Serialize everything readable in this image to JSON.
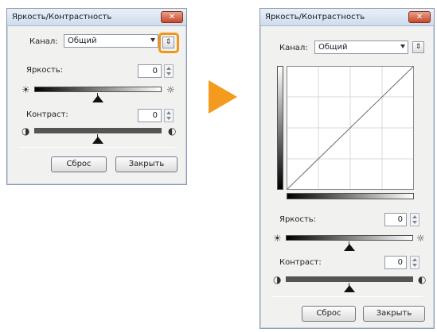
{
  "window1": {
    "title": "Яркость/Контрастность",
    "close": "✕",
    "channel_label": "Канал:",
    "channel_value": "Общий",
    "toggle_icon": "⇕",
    "brightness_label": "Яркость:",
    "brightness_value": "0",
    "contrast_label": "Контраст:",
    "contrast_value": "0",
    "reset_label": "Сброс",
    "close_label": "Закрыть"
  },
  "window2": {
    "title": "Яркость/Контрастность",
    "close": "✕",
    "channel_label": "Канал:",
    "channel_value": "Общий",
    "toggle_icon": "⇕",
    "brightness_label": "Яркость:",
    "brightness_value": "0",
    "contrast_label": "Контраст:",
    "contrast_value": "0",
    "reset_label": "Сброс",
    "close_label": "Закрыть"
  },
  "icons": {
    "brightness_low": "☀",
    "brightness_high": "☼",
    "contrast_low": "◑",
    "contrast_high": "◐"
  },
  "colors": {
    "accent_orange": "#f39a1f",
    "close_red": "#c44a2d"
  }
}
